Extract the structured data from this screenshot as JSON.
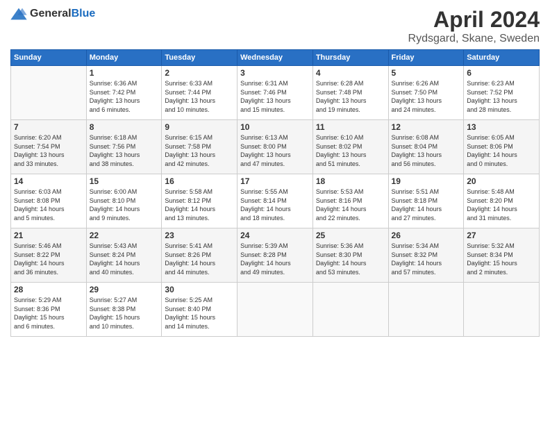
{
  "header": {
    "logo_general": "General",
    "logo_blue": "Blue",
    "title": "April 2024",
    "location": "Rydsgard, Skane, Sweden"
  },
  "calendar": {
    "days_of_week": [
      "Sunday",
      "Monday",
      "Tuesday",
      "Wednesday",
      "Thursday",
      "Friday",
      "Saturday"
    ],
    "weeks": [
      [
        {
          "day": "",
          "info": ""
        },
        {
          "day": "1",
          "info": "Sunrise: 6:36 AM\nSunset: 7:42 PM\nDaylight: 13 hours\nand 6 minutes."
        },
        {
          "day": "2",
          "info": "Sunrise: 6:33 AM\nSunset: 7:44 PM\nDaylight: 13 hours\nand 10 minutes."
        },
        {
          "day": "3",
          "info": "Sunrise: 6:31 AM\nSunset: 7:46 PM\nDaylight: 13 hours\nand 15 minutes."
        },
        {
          "day": "4",
          "info": "Sunrise: 6:28 AM\nSunset: 7:48 PM\nDaylight: 13 hours\nand 19 minutes."
        },
        {
          "day": "5",
          "info": "Sunrise: 6:26 AM\nSunset: 7:50 PM\nDaylight: 13 hours\nand 24 minutes."
        },
        {
          "day": "6",
          "info": "Sunrise: 6:23 AM\nSunset: 7:52 PM\nDaylight: 13 hours\nand 28 minutes."
        }
      ],
      [
        {
          "day": "7",
          "info": "Sunrise: 6:20 AM\nSunset: 7:54 PM\nDaylight: 13 hours\nand 33 minutes."
        },
        {
          "day": "8",
          "info": "Sunrise: 6:18 AM\nSunset: 7:56 PM\nDaylight: 13 hours\nand 38 minutes."
        },
        {
          "day": "9",
          "info": "Sunrise: 6:15 AM\nSunset: 7:58 PM\nDaylight: 13 hours\nand 42 minutes."
        },
        {
          "day": "10",
          "info": "Sunrise: 6:13 AM\nSunset: 8:00 PM\nDaylight: 13 hours\nand 47 minutes."
        },
        {
          "day": "11",
          "info": "Sunrise: 6:10 AM\nSunset: 8:02 PM\nDaylight: 13 hours\nand 51 minutes."
        },
        {
          "day": "12",
          "info": "Sunrise: 6:08 AM\nSunset: 8:04 PM\nDaylight: 13 hours\nand 56 minutes."
        },
        {
          "day": "13",
          "info": "Sunrise: 6:05 AM\nSunset: 8:06 PM\nDaylight: 14 hours\nand 0 minutes."
        }
      ],
      [
        {
          "day": "14",
          "info": "Sunrise: 6:03 AM\nSunset: 8:08 PM\nDaylight: 14 hours\nand 5 minutes."
        },
        {
          "day": "15",
          "info": "Sunrise: 6:00 AM\nSunset: 8:10 PM\nDaylight: 14 hours\nand 9 minutes."
        },
        {
          "day": "16",
          "info": "Sunrise: 5:58 AM\nSunset: 8:12 PM\nDaylight: 14 hours\nand 13 minutes."
        },
        {
          "day": "17",
          "info": "Sunrise: 5:55 AM\nSunset: 8:14 PM\nDaylight: 14 hours\nand 18 minutes."
        },
        {
          "day": "18",
          "info": "Sunrise: 5:53 AM\nSunset: 8:16 PM\nDaylight: 14 hours\nand 22 minutes."
        },
        {
          "day": "19",
          "info": "Sunrise: 5:51 AM\nSunset: 8:18 PM\nDaylight: 14 hours\nand 27 minutes."
        },
        {
          "day": "20",
          "info": "Sunrise: 5:48 AM\nSunset: 8:20 PM\nDaylight: 14 hours\nand 31 minutes."
        }
      ],
      [
        {
          "day": "21",
          "info": "Sunrise: 5:46 AM\nSunset: 8:22 PM\nDaylight: 14 hours\nand 36 minutes."
        },
        {
          "day": "22",
          "info": "Sunrise: 5:43 AM\nSunset: 8:24 PM\nDaylight: 14 hours\nand 40 minutes."
        },
        {
          "day": "23",
          "info": "Sunrise: 5:41 AM\nSunset: 8:26 PM\nDaylight: 14 hours\nand 44 minutes."
        },
        {
          "day": "24",
          "info": "Sunrise: 5:39 AM\nSunset: 8:28 PM\nDaylight: 14 hours\nand 49 minutes."
        },
        {
          "day": "25",
          "info": "Sunrise: 5:36 AM\nSunset: 8:30 PM\nDaylight: 14 hours\nand 53 minutes."
        },
        {
          "day": "26",
          "info": "Sunrise: 5:34 AM\nSunset: 8:32 PM\nDaylight: 14 hours\nand 57 minutes."
        },
        {
          "day": "27",
          "info": "Sunrise: 5:32 AM\nSunset: 8:34 PM\nDaylight: 15 hours\nand 2 minutes."
        }
      ],
      [
        {
          "day": "28",
          "info": "Sunrise: 5:29 AM\nSunset: 8:36 PM\nDaylight: 15 hours\nand 6 minutes."
        },
        {
          "day": "29",
          "info": "Sunrise: 5:27 AM\nSunset: 8:38 PM\nDaylight: 15 hours\nand 10 minutes."
        },
        {
          "day": "30",
          "info": "Sunrise: 5:25 AM\nSunset: 8:40 PM\nDaylight: 15 hours\nand 14 minutes."
        },
        {
          "day": "",
          "info": ""
        },
        {
          "day": "",
          "info": ""
        },
        {
          "day": "",
          "info": ""
        },
        {
          "day": "",
          "info": ""
        }
      ]
    ]
  }
}
